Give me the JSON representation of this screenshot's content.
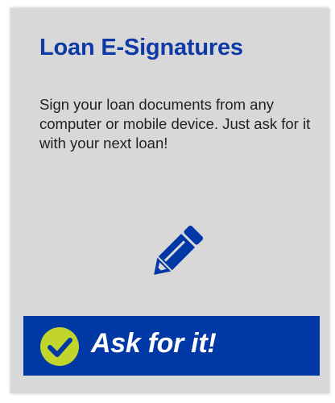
{
  "card": {
    "title": "Loan E-Signatures",
    "description": "Sign your loan documents from any computer or mobile device. Just ask for it with your next loan!",
    "icon": "pencil-icon"
  },
  "cta": {
    "label": "Ask for it!",
    "icon": "check-circle-icon"
  },
  "colors": {
    "accent": "#0039a6",
    "title": "#0e3aa6",
    "check": "#c2d52c",
    "card_background": "#d8d8d8"
  }
}
